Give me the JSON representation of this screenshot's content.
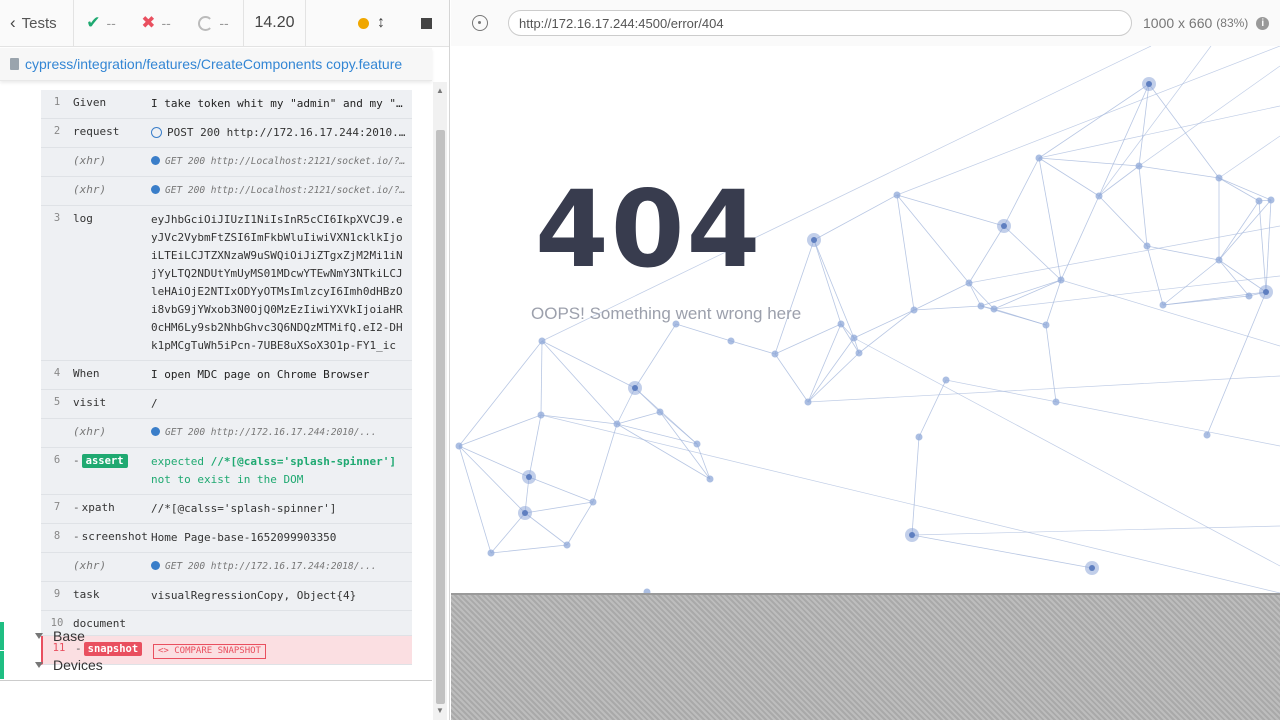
{
  "reporter": {
    "tests_label": "Tests",
    "passed": "--",
    "failed": "--",
    "pending": "--",
    "duration": "14.20",
    "spec_path": "cypress/integration/features/CreateComponents copy.feature",
    "commands": [
      {
        "num": "1",
        "name": "Given",
        "msg": "I take token whit my \"admin\" and my \"...",
        "kind": "step"
      },
      {
        "num": "2",
        "name": "request",
        "msg": "POST 200 http://172.16.17.244:2010...",
        "kind": "request"
      },
      {
        "num": "",
        "name": "(xhr)",
        "msg": "GET 200 http://Localhost:2121/socket.io/?...",
        "kind": "xhr"
      },
      {
        "num": "",
        "name": "(xhr)",
        "msg": "GET 200 http://Localhost:2121/socket.io/?...",
        "kind": "xhr"
      },
      {
        "num": "3",
        "name": "log",
        "msg": "eyJhbGciOiJIUzI1NiIsInR5cCI6IkpXVCJ9.eyJVc2VybmFtZSI6ImFkbWluIiwiVXN1cklkIjoiLTEiLCJTZXNzaW9uSWQiOiJiZTgxZjM2Mi1iNjYyLTQ2NDUtYmUyMS01MDcwYTEwNmY3NTkiLCJleHAiOjE2NTIxODYyOTMsImlzcyI6Imh0dHBzOi8vbG9jYWxob3N0OjQ0MzEzIiwiYXVkIjoiaHR0cHM6Ly9sb2NhbGhvc3Q6NDQzMTMifQ.eI2-DHk1pMCgTuWh5iPcn-7UBE8uXSoX3O1p-FY1_ic",
        "kind": "step"
      },
      {
        "num": "4",
        "name": "When",
        "msg": "I open MDC page on Chrome Browser",
        "kind": "step"
      },
      {
        "num": "5",
        "name": "visit",
        "msg": "/",
        "kind": "step"
      },
      {
        "num": "",
        "name": "(xhr)",
        "msg": "GET 200 http://172.16.17.244:2010/...",
        "kind": "xhr"
      },
      {
        "num": "6",
        "name": "assert",
        "msg_parts": {
          "pre": "expected ",
          "sel": "//*[@calss='splash-spinner']",
          "post": " not to exist in the DOM"
        },
        "kind": "assert"
      },
      {
        "num": "7",
        "name": "xpath",
        "msg": "//*[@calss='splash-spinner']",
        "kind": "child"
      },
      {
        "num": "8",
        "name": "screenshot",
        "msg": "Home Page-base-1652099903350",
        "kind": "child"
      },
      {
        "num": "",
        "name": "(xhr)",
        "msg": "GET 200 http://172.16.17.244:2018/...",
        "kind": "xhr"
      },
      {
        "num": "9",
        "name": "task",
        "msg": "visualRegressionCopy, Object{4}",
        "kind": "step"
      },
      {
        "num": "10",
        "name": "document",
        "msg": "",
        "kind": "step"
      },
      {
        "num": "11",
        "name": "snapshot",
        "msg": "<> COMPARE SNAPSHOT",
        "kind": "snapshot"
      }
    ],
    "suites": [
      "Base",
      "Devices"
    ]
  },
  "aut": {
    "url": "http://172.16.17.244:4500/error/404",
    "viewport": "1000 x 660",
    "zoom": "(83%)",
    "error_code": "404",
    "error_message": "OOPS! Something went wrong here"
  },
  "colors": {
    "pass": "#1fa971",
    "fail": "#e94f5f",
    "link": "#3386d4",
    "network": "#a5b8dc"
  },
  "icons": [
    "chevron-left-icon",
    "check-icon",
    "x-icon",
    "spinner-icon",
    "orange-dot-icon",
    "up-down-icon",
    "stop-icon",
    "file-icon",
    "crosshair-icon",
    "info-icon"
  ]
}
